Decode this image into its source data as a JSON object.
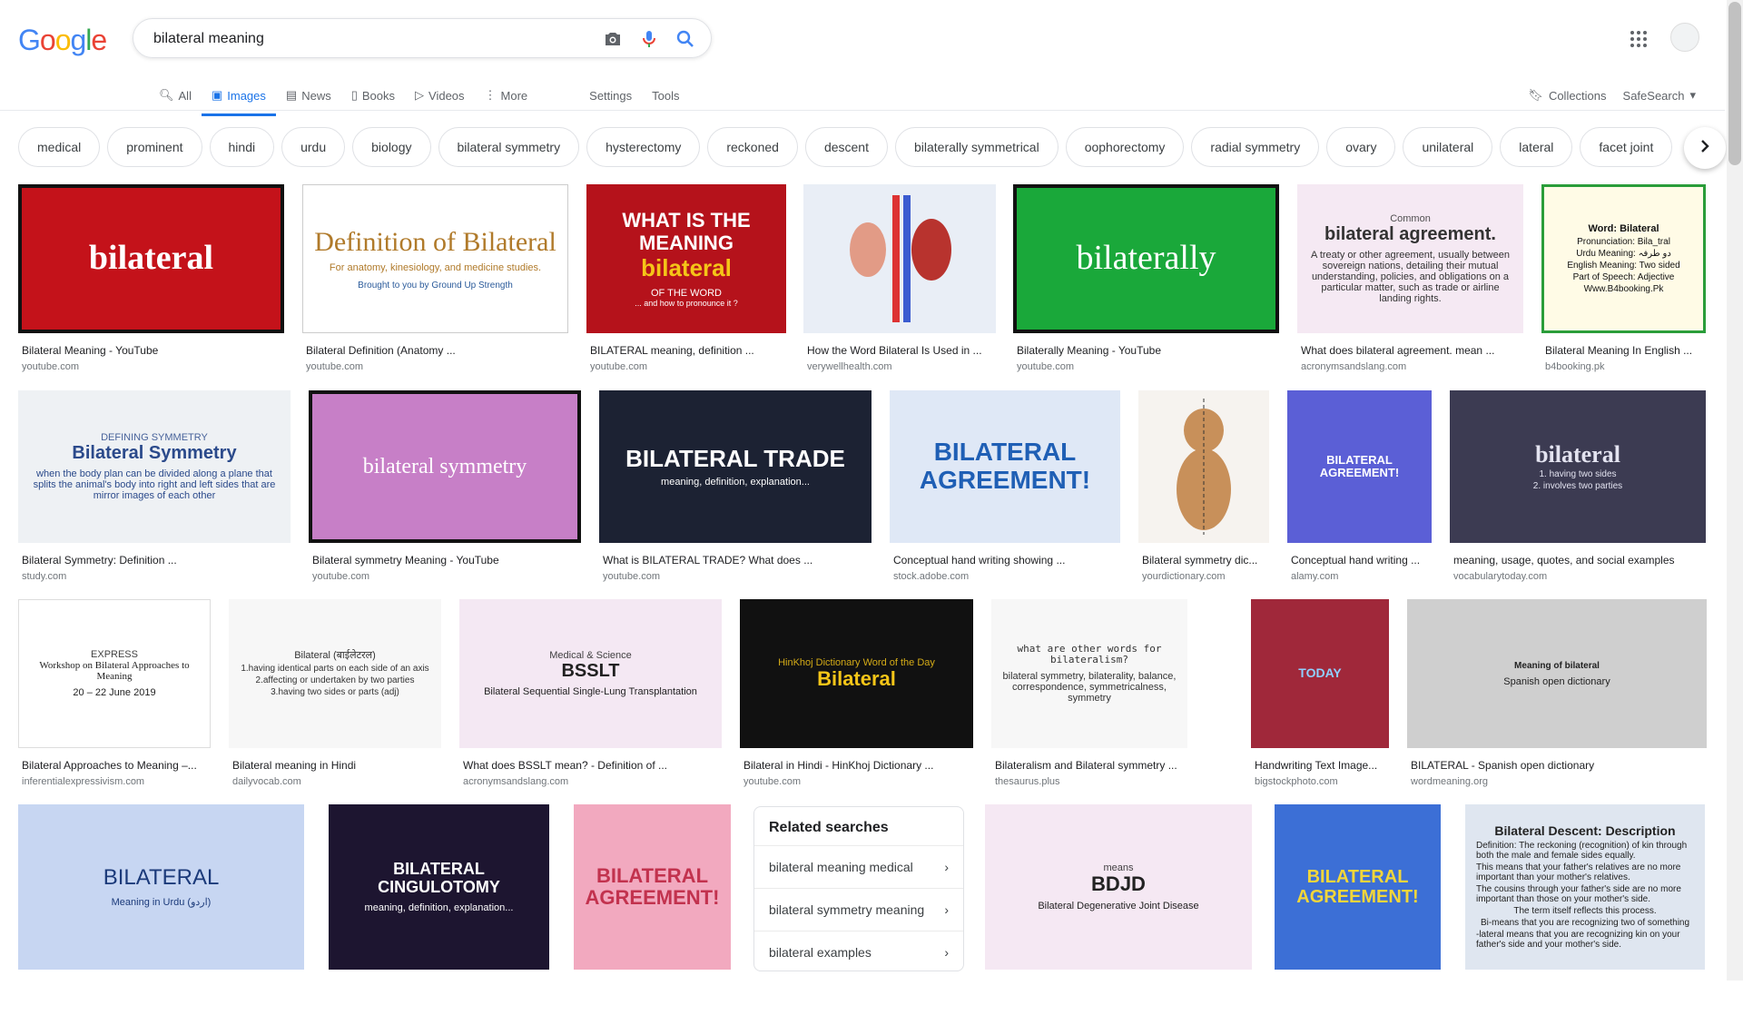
{
  "logo": {
    "letters": [
      "G",
      "o",
      "o",
      "g",
      "l",
      "e"
    ],
    "colors": [
      "#4285F4",
      "#EA4335",
      "#FBBC05",
      "#4285F4",
      "#34A853",
      "#EA4335"
    ]
  },
  "search": {
    "value": "bilateral meaning",
    "icons": [
      "camera-icon",
      "mic-icon",
      "search-icon"
    ]
  },
  "tabs": [
    {
      "label": "All",
      "icon": "search-icon"
    },
    {
      "label": "Images",
      "icon": "image-icon"
    },
    {
      "label": "News",
      "icon": "news-icon"
    },
    {
      "label": "Books",
      "icon": "book-icon"
    },
    {
      "label": "Videos",
      "icon": "video-icon"
    },
    {
      "label": "More",
      "icon": "more-icon"
    }
  ],
  "tools": {
    "settings": "Settings",
    "tools": "Tools"
  },
  "right": {
    "collections": "Collections",
    "safesearch": "SafeSearch"
  },
  "chips": [
    "medical",
    "prominent",
    "hindi",
    "urdu",
    "biology",
    "bilateral symmetry",
    "hysterectomy",
    "reckoned",
    "descent",
    "bilaterally symmetrical",
    "oophorectomy",
    "radial symmetry",
    "ovary",
    "unilateral",
    "lateral",
    "facet joint"
  ],
  "images": {
    "row1": [
      {
        "caption": "Bilateral Meaning - YouTube",
        "domain": "youtube.com",
        "thumb": "bilateral"
      },
      {
        "caption": "Bilateral Definition (Anatomy ...",
        "domain": "youtube.com",
        "thumb": "Definition of Bilateral",
        "thumb_sub": "For anatomy, kinesiology, and medicine studies.",
        "thumb_credit": "Brought to you by Ground Up Strength"
      },
      {
        "caption": "BILATERAL meaning, definition ...",
        "domain": "youtube.com",
        "thumb": "WHAT IS THE MEANING",
        "thumb_sub": "OF THE WORD",
        "thumb_word": "bilateral",
        "thumb_foot": "... and how to pronounce it ?"
      },
      {
        "caption": "How the Word Bilateral Is Used in ...",
        "domain": "verywellhealth.com",
        "thumb": ""
      },
      {
        "caption": "Bilaterally Meaning - YouTube",
        "domain": "youtube.com",
        "thumb": "bilaterally"
      },
      {
        "caption": "What does bilateral agreement. mean ...",
        "domain": "acronymsandslang.com",
        "thumb": "bilateral agreement.",
        "thumb_top": "Common",
        "thumb_sub": "A treaty or other agreement, usually between sovereign nations, detailing their mutual understanding, policies, and obligations on a particular matter, such as trade or airline landing rights."
      },
      {
        "caption": "Bilateral Meaning In English ...",
        "domain": "b4booking.pk",
        "thumb": "Word: Bilateral",
        "thumb_lines": [
          "Pronunciation: Bila_tral",
          "Urdu Meaning: دو طرفہ",
          "English Meaning: Two sided",
          "Part of Speech: Adjective",
          "Www.B4booking.Pk"
        ]
      }
    ],
    "row2": [
      {
        "caption": "Bilateral Symmetry: Definition ...",
        "domain": "study.com",
        "thumb": "Bilateral Symmetry",
        "thumb_top": "DEFINING SYMMETRY",
        "thumb_sub": "when the body plan can be divided along a plane that splits the animal's body into right and left sides that are mirror images of each other"
      },
      {
        "caption": "Bilateral symmetry Meaning - YouTube",
        "domain": "youtube.com",
        "thumb": "bilateral symmetry"
      },
      {
        "caption": "What is BILATERAL TRADE? What does ...",
        "domain": "youtube.com",
        "thumb": "BILATERAL TRADE",
        "thumb_sub": "meaning, definition, explanation..."
      },
      {
        "caption": "Conceptual hand writing showing ...",
        "domain": "stock.adobe.com",
        "thumb": "BILATERAL AGREEMENT!"
      },
      {
        "caption": "Bilateral symmetry dic...",
        "domain": "yourdictionary.com",
        "thumb": ""
      },
      {
        "caption": "Conceptual hand writing ...",
        "domain": "alamy.com",
        "thumb": "BILATERAL AGREEMENT!"
      },
      {
        "caption": "meaning, usage, quotes, and social examples",
        "domain": "vocabularytoday.com",
        "thumb": "bilateral",
        "thumb_lines": [
          "1. having two sides",
          "2. involves two parties"
        ]
      }
    ],
    "row3": [
      {
        "caption": "Bilateral Approaches to Meaning –...",
        "domain": "inferentialexpressivism.com",
        "thumb": "Workshop on Bilateral Approaches to Meaning",
        "thumb_top": "EXPRESS",
        "thumb_sub": "20 – 22 June 2019"
      },
      {
        "caption": "Bilateral meaning in Hindi",
        "domain": "dailyvocab.com",
        "thumb": "Bilateral (बाईलेटरल)",
        "thumb_lines": [
          "1.having identical parts on each side of an axis",
          "2.affecting or undertaken by two parties",
          "3.having two sides or parts (adj)"
        ]
      },
      {
        "caption": "What does BSSLT mean? - Definition of ...",
        "domain": "acronymsandslang.com",
        "thumb": "BSSLT",
        "thumb_top": "Medical & Science",
        "thumb_sub": "Bilateral Sequential Single-Lung Transplantation"
      },
      {
        "caption": "Bilateral in Hindi - HinKhoj Dictionary ...",
        "domain": "youtube.com",
        "thumb": "Bilateral",
        "thumb_top": "HinKhoj Dictionary Word of the Day"
      },
      {
        "caption": "Bilateralism and Bilateral symmetry ...",
        "domain": "thesaurus.plus",
        "thumb": "what are other words for bilateralism?",
        "thumb_sub": "bilateral symmetry, bilaterality, balance, correspondence, symmetricalness, symmetry"
      },
      {
        "caption": "Handwriting Text Image...",
        "domain": "bigstockphoto.com",
        "thumb": "TODAY"
      },
      {
        "caption": "BILATERAL - Spanish open dictionary",
        "domain": "wordmeaning.org",
        "thumb": "Meaning of bilateral",
        "thumb_sub": "Spanish open dictionary"
      }
    ],
    "row4": [
      {
        "thumb": "BILATERAL",
        "thumb_sub": "Meaning in Urdu (اردو)"
      },
      {
        "thumb": "BILATERAL CINGULOTOMY",
        "thumb_sub": "meaning, definition, explanation..."
      },
      {
        "thumb": "BILATERAL AGREEMENT!"
      },
      {
        "thumb": "BDJD",
        "thumb_top": "means",
        "thumb_sub": "Bilateral Degenerative Joint Disease"
      },
      {
        "thumb": "BILATERAL AGREEMENT!"
      },
      {
        "thumb": "Bilateral Descent: Description",
        "thumb_lines": [
          "Definition: The reckoning (recognition) of kin through both the male and female sides equally.",
          "This means that your father's relatives are no more important than your mother's relatives.",
          "The cousins through your father's side are no more important than those on your mother's side.",
          "The term itself reflects this process.",
          "Bi-means that you are recognizing two of something",
          "-lateral means that you are recognizing kin on your father's side and your mother's side."
        ]
      }
    ]
  },
  "related": {
    "title": "Related searches",
    "items": [
      "bilateral meaning medical",
      "bilateral symmetry meaning",
      "bilateral examples"
    ]
  }
}
